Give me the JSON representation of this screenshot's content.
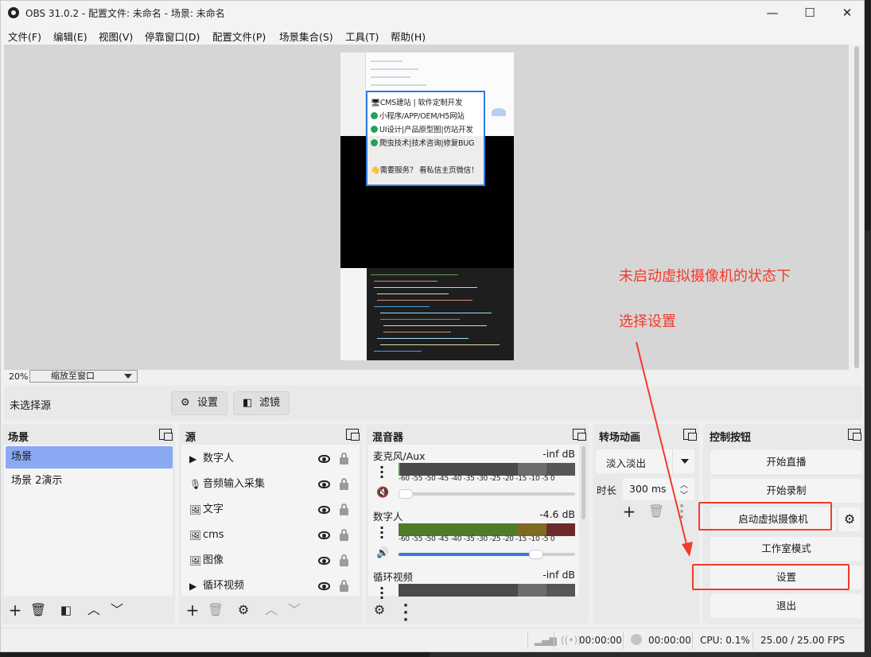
{
  "window": {
    "title": "OBS 31.0.2 - 配置文件: 未命名 - 场景: 未命名",
    "minimize": "—",
    "maximize": "☐",
    "close": "✕"
  },
  "menu": [
    "文件(F)",
    "编辑(E)",
    "视图(V)",
    "停靠窗口(D)",
    "配置文件(P)",
    "场景集合(S)",
    "工具(T)",
    "帮助(H)"
  ],
  "preview": {
    "popup_lines": [
      "🖥CMS建站 | 软件定制开发",
      "小程序/APP/OEM/H5网站",
      "UI设计|产品原型图|仿站开发",
      "爬虫技术|技术咨询|修复BUG",
      "👋需要服务？ 看私信主页微信！"
    ]
  },
  "zoom": {
    "percent": "20%",
    "mode": "缩放至窗口"
  },
  "source_toolbar": {
    "no_selection": "未选择源",
    "settings": "设置",
    "filters": "滤镜"
  },
  "scenes": {
    "title": "场景",
    "items": [
      "场景",
      "场景 2演示"
    ],
    "selected_index": 0
  },
  "sources": {
    "title": "源",
    "items": [
      {
        "name": "数字人",
        "icon": "play-icon"
      },
      {
        "name": "音频输入采集",
        "icon": "microphone-icon"
      },
      {
        "name": "文字",
        "icon": "image-icon"
      },
      {
        "name": "cms",
        "icon": "image-icon"
      },
      {
        "name": "图像",
        "icon": "image-icon"
      },
      {
        "name": "循环视频",
        "icon": "play-icon"
      }
    ]
  },
  "mixer": {
    "title": "混音器",
    "scale": "-60 -55 -50 -45 -40 -35 -30 -25 -20 -15 -10 -5 0",
    "channels": [
      {
        "name": "麦克风/Aux",
        "db": "-inf dB",
        "muted": true,
        "volume": 0.0
      },
      {
        "name": "数字人",
        "db": "-4.6 dB",
        "muted": false,
        "volume": 0.78
      },
      {
        "name": "循环视频",
        "db": "-inf dB",
        "muted": false,
        "volume": 0.0
      }
    ]
  },
  "transitions": {
    "title": "转场动画",
    "current": "淡入淡出",
    "duration_label": "时长",
    "duration": "300 ms"
  },
  "controls": {
    "title": "控制按钮",
    "start_streaming": "开始直播",
    "start_recording": "开始录制",
    "start_virtual_camera": "启动虚拟摄像机",
    "studio_mode": "工作室模式",
    "settings": "设置",
    "exit": "退出"
  },
  "status": {
    "stream_time": "00:00:00",
    "record_time": "00:00:00",
    "cpu": "CPU: 0.1%",
    "fps": "25.00 / 25.00 FPS"
  },
  "annotation": {
    "line1": "未启动虚拟摄像机的状态下",
    "line2": "选择设置",
    "color": "#f23a2c"
  }
}
